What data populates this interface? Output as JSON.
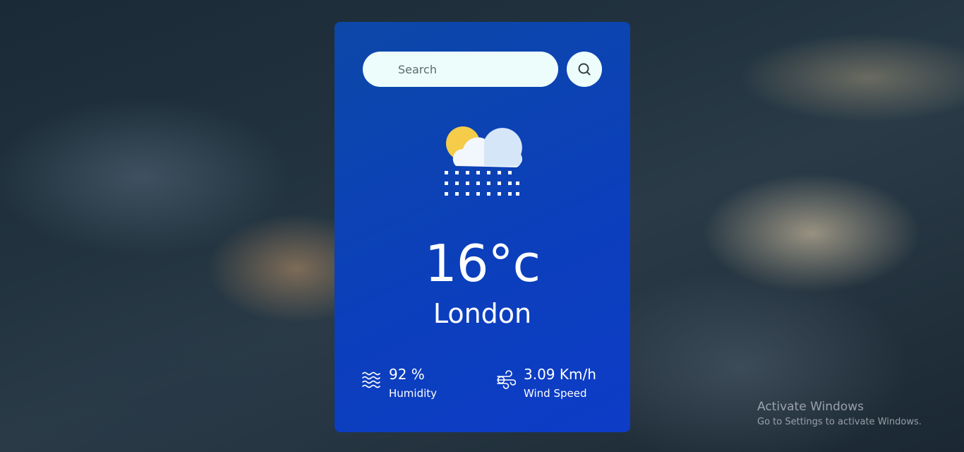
{
  "search": {
    "placeholder": "Search",
    "button_icon": "search-icon"
  },
  "weather": {
    "icon": "cloud-sun-snow-icon",
    "temperature": "16°c",
    "city": "London"
  },
  "details": {
    "humidity": {
      "icon": "humidity-waves-icon",
      "value": "92 %",
      "label": "Humidity"
    },
    "wind": {
      "icon": "wind-icon",
      "value": "3.09 Km/h",
      "label": "Wind Speed"
    }
  },
  "watermark": {
    "title": "Activate Windows",
    "subtitle": "Go to Settings to activate Windows."
  },
  "colors": {
    "card_bg": "#0b3fbb",
    "search_bg": "#ecfdfb",
    "sun": "#f5cc4a",
    "cloud": "#e6f0fb"
  }
}
